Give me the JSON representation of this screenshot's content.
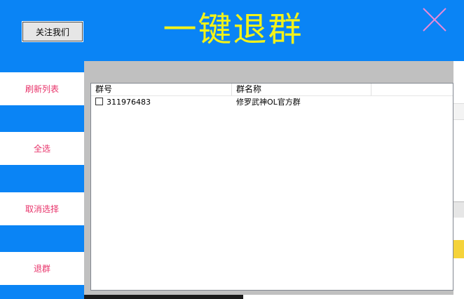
{
  "header": {
    "follow_label": "关注我们",
    "title": "一键退群",
    "close_icon": "close-icon",
    "title_color": "#f2f21a",
    "bg_color": "#0a84f5"
  },
  "sidebar": {
    "items": [
      {
        "label": "刷新列表"
      },
      {
        "label": "全选"
      },
      {
        "label": "取消选择"
      },
      {
        "label": "退群"
      }
    ],
    "label_color": "#e8336a"
  },
  "list": {
    "columns": [
      "群号",
      "群名称",
      ""
    ],
    "rows": [
      {
        "checked": false,
        "group_id": "311976483",
        "group_name": "修罗武神OL官方群"
      }
    ]
  }
}
